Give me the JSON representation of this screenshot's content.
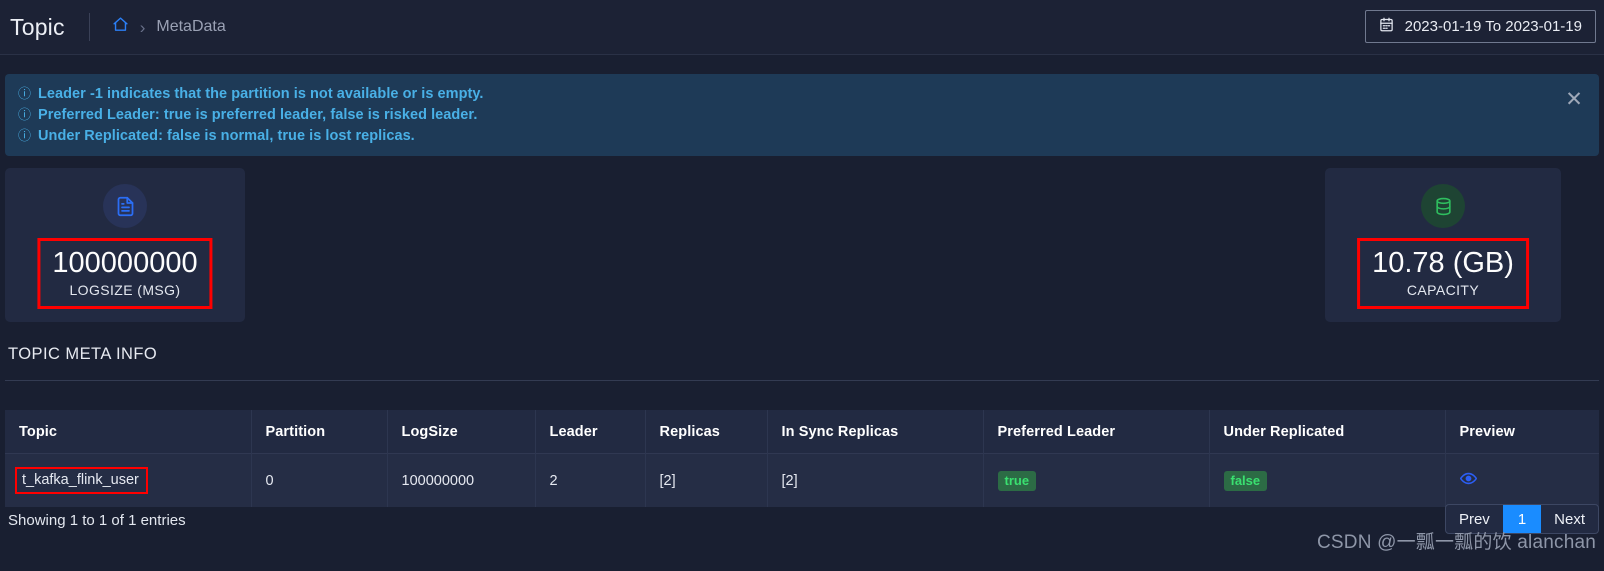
{
  "header": {
    "title": "Topic",
    "home_icon": "home-icon",
    "separator": "›",
    "breadcrumb": "MetaData",
    "daterange": {
      "icon": "calendar-icon",
      "value": "2023-01-19 To 2023-01-19"
    }
  },
  "alert": {
    "icon": "info-circle-icon",
    "close_label": "✕",
    "lines": [
      "Leader -1 indicates that the partition is not available or is empty.",
      "Preferred Leader: true is preferred leader, false is risked leader.",
      "Under Replicated: false is normal, true is lost replicas."
    ],
    "text_color": "#49b0e6",
    "bg_color": "#1e3a57"
  },
  "cards": [
    {
      "icon": "file-document-icon",
      "icon_color": "#2b6ef5",
      "value": "100000000",
      "label": "LOGSIZE (MSG)"
    },
    {
      "icon": "database-icon",
      "icon_color": "#2fbf5f",
      "value": "10.78 (GB)",
      "label": "CAPACITY"
    }
  ],
  "section": {
    "title": "TOPIC META INFO"
  },
  "table": {
    "columns": [
      "Topic",
      "Partition",
      "LogSize",
      "Leader",
      "Replicas",
      "In Sync Replicas",
      "Preferred Leader",
      "Under Replicated",
      "Preview"
    ],
    "rows": [
      {
        "topic": "t_kafka_flink_user",
        "partition": "0",
        "logsize": "100000000",
        "leader": "2",
        "replicas": "[2]",
        "in_sync_replicas": "[2]",
        "preferred_leader": "true",
        "under_replicated": "false",
        "preview_icon": "eye-icon"
      }
    ]
  },
  "footer": {
    "entries_text": "Showing 1 to 1 of 1 entries",
    "pagination": {
      "prev": "Prev",
      "current": "1",
      "next": "Next"
    },
    "watermark": "CSDN @一瓢一瓢的饮 alanchan"
  },
  "colors": {
    "page_bg": "#191f31",
    "card_bg": "#222a42",
    "accent_blue": "#1a8cff",
    "badge_green": "#3ae070",
    "annotation_red": "#ff0000"
  }
}
